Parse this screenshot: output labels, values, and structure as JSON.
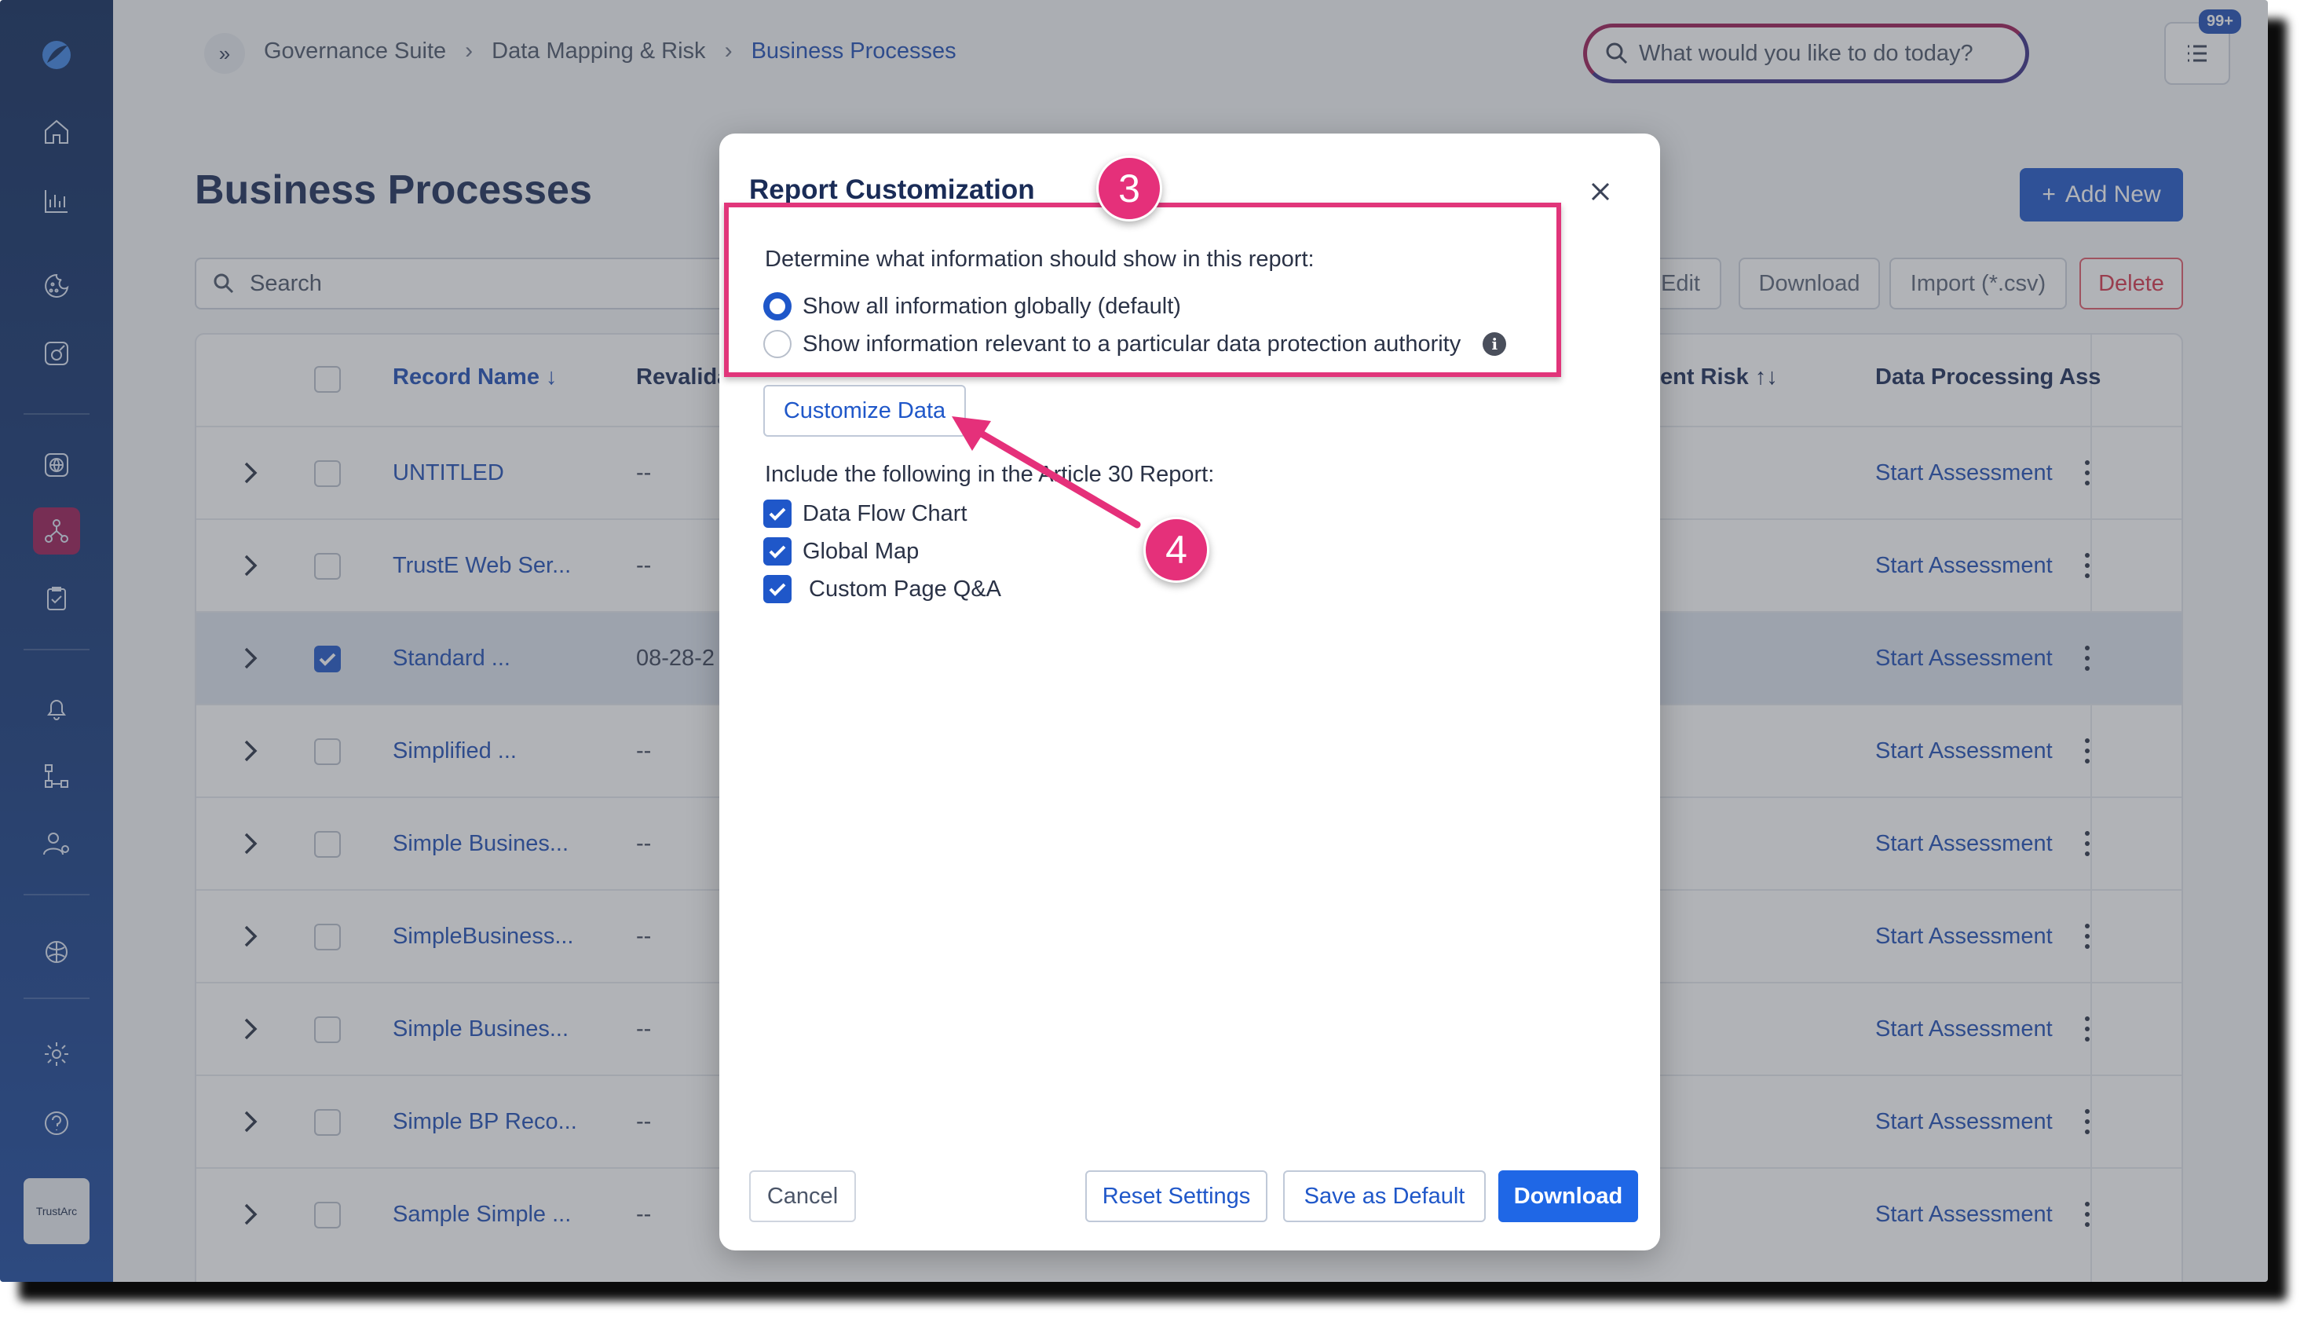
{
  "breadcrumb": [
    "Governance Suite",
    "Data Mapping & Risk",
    "Business Processes"
  ],
  "global_search": {
    "placeholder": "What would you like to do today?"
  },
  "notifications": {
    "badge": "99+"
  },
  "page": {
    "title": "Business Processes",
    "add_new_label": "Add New",
    "search_placeholder": "Search",
    "toolbar": [
      "Edit",
      "Download",
      "Import (*.csv)",
      "Delete"
    ]
  },
  "sidebar": {
    "brand_label": "TrustArc"
  },
  "table": {
    "headers": {
      "record_name": "Record Name",
      "revalidation": "Revalida",
      "risk": "ent Risk",
      "dpa": "Data Processing Ass"
    },
    "rows": [
      {
        "name": "UNTITLED",
        "revalidation": "--",
        "assessment": "Start Assessment",
        "selected": false
      },
      {
        "name": "TrustE Web Ser...",
        "revalidation": "--",
        "assessment": "Start Assessment",
        "selected": false
      },
      {
        "name": "Standard ...",
        "revalidation": "08-28-2",
        "assessment": "Start Assessment",
        "selected": true
      },
      {
        "name": "Simplified ...",
        "revalidation": "--",
        "assessment": "Start Assessment",
        "selected": false
      },
      {
        "name": "Simple Busines...",
        "revalidation": "--",
        "assessment": "Start Assessment",
        "selected": false
      },
      {
        "name": "SimpleBusiness...",
        "revalidation": "--",
        "assessment": "Start Assessment",
        "selected": false
      },
      {
        "name": "Simple Busines...",
        "revalidation": "--",
        "assessment": "Start Assessment",
        "selected": false
      },
      {
        "name": "Simple BP Reco...",
        "revalidation": "--",
        "assessment": "Start Assessment",
        "selected": false
      },
      {
        "name": "Sample Simple ...",
        "revalidation": "--",
        "assessment": "Start Assessment",
        "selected": false
      }
    ]
  },
  "modal": {
    "title": "Report Customization",
    "determine_label": "Determine what information should show in this report:",
    "radio_options": [
      {
        "label": "Show all information globally (default)",
        "selected": true
      },
      {
        "label": "Show information relevant to a particular data protection authority",
        "selected": false
      }
    ],
    "customize_button": "Customize Data",
    "include_label": "Include the following in the Article 30 Report:",
    "checkboxes": [
      {
        "label": "Data Flow Chart",
        "checked": true
      },
      {
        "label": "Global Map",
        "checked": true
      },
      {
        "label": "Custom Page Q&A",
        "checked": true
      }
    ],
    "buttons": {
      "cancel": "Cancel",
      "reset": "Reset Settings",
      "save_default": "Save as Default",
      "download": "Download"
    }
  },
  "annotations": {
    "step_a": "3",
    "step_b": "4",
    "accent_color": "#e5307a"
  }
}
